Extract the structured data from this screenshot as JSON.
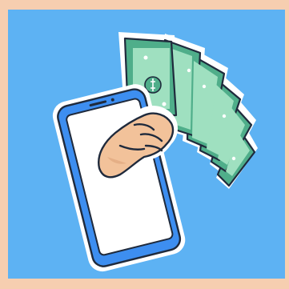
{
  "illustration": {
    "subject": "hand-holding-cash-from-smartphone",
    "icons": [
      "smartphone-icon",
      "hand-icon",
      "banknote-fan-icon",
      "dollar-sign-icon"
    ],
    "colors": {
      "border": "#f6ceb0",
      "background": "#5db2f3",
      "outline": "#1f2a3c",
      "phone_body": "#3d8ef0",
      "phone_screen": "#ffffff",
      "skin": "#f2c29a",
      "skin_shadow": "#e0a77e",
      "cash_dark": "#4fae8a",
      "cash_light": "#9fe0c0",
      "sticker_edge": "#ffffff"
    }
  }
}
